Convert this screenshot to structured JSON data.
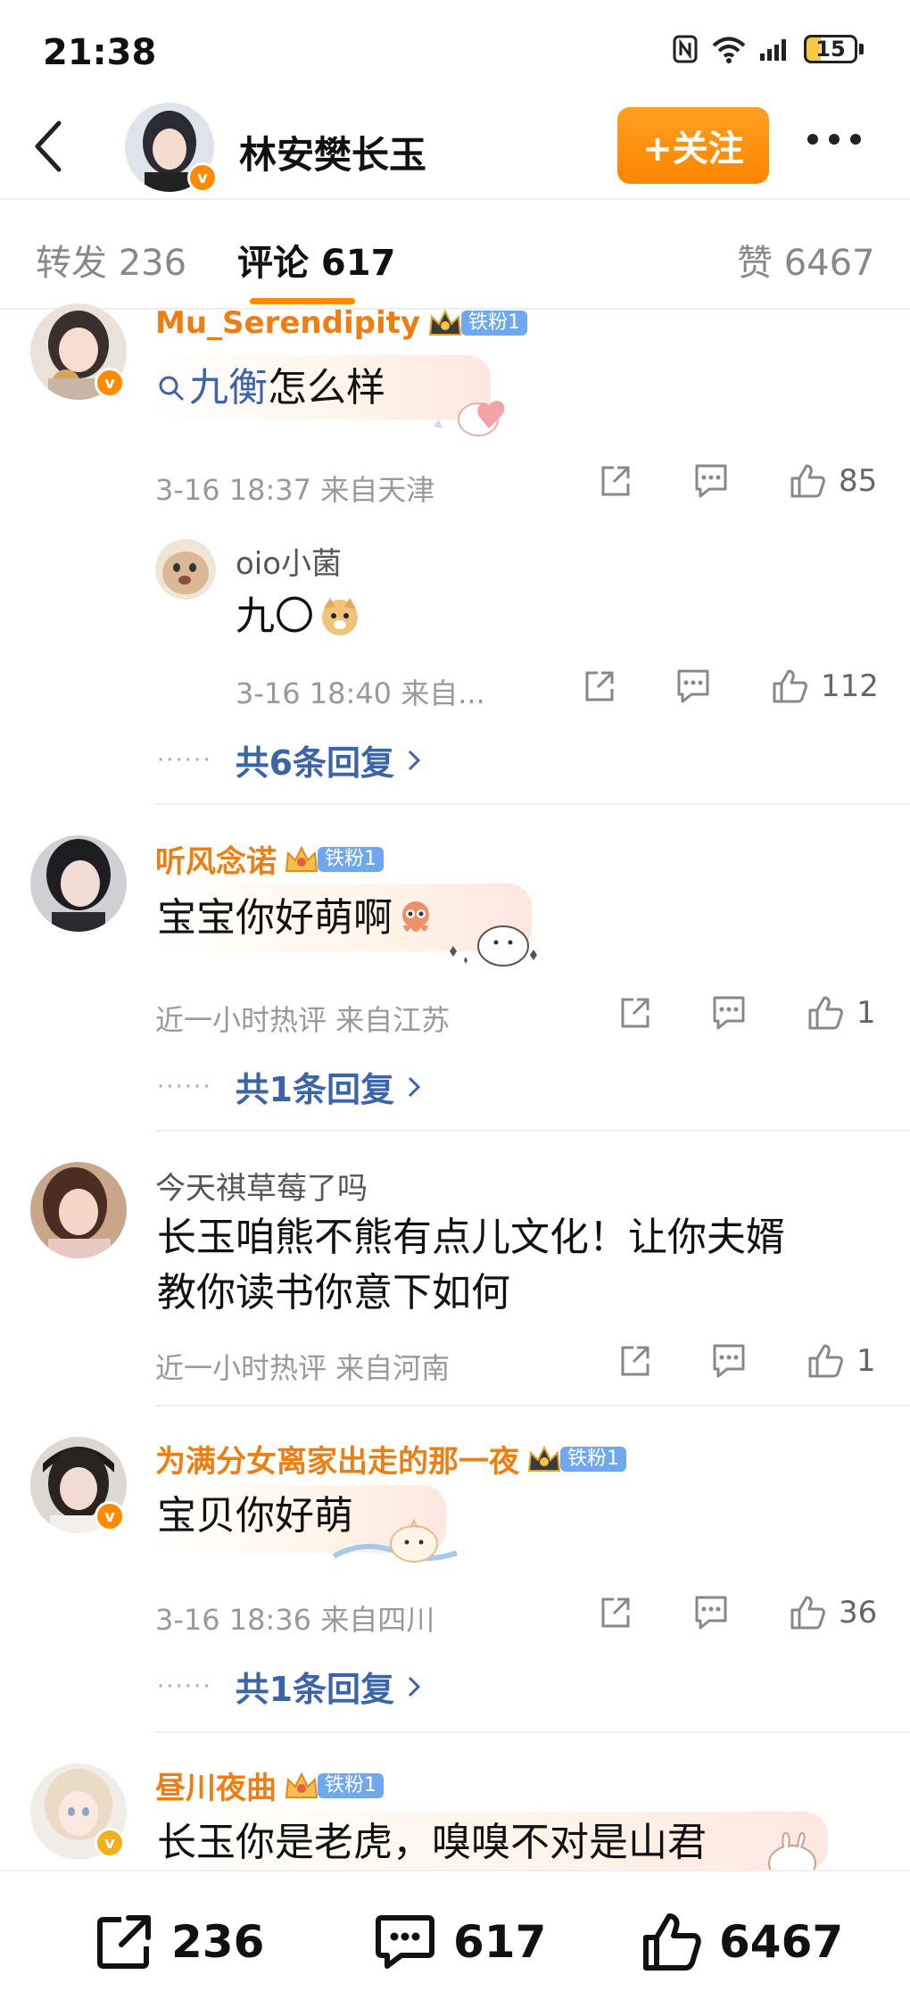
{
  "status_bar": {
    "time": "21:38",
    "battery": "15"
  },
  "header": {
    "user_name": "林安樊长玉",
    "follow_label": "+关注"
  },
  "tabs": [
    {
      "label": "转发 236"
    },
    {
      "label": "评论 617"
    },
    {
      "label": "赞 6467"
    }
  ],
  "comments": [
    {
      "user": "Mu_Serendipity",
      "fan_badge": "铁粉1",
      "text_search": "九衡",
      "text_rest": " 怎么样",
      "time_location": "3-16 18:37 来自天津",
      "likes": "85",
      "reply": {
        "user": "oio小菌",
        "text": "九〇",
        "time_location": "3-16 18:40 来自...",
        "likes": "112"
      },
      "replies_label": "共6条回复",
      "dots": "······"
    },
    {
      "user": "听风念诺",
      "fan_badge": "铁粉1",
      "text": "宝宝你好萌啊",
      "time_location": "近一小时热评 来自江苏",
      "likes": "1",
      "replies_label": "共1条回复",
      "dots": "······"
    },
    {
      "user": "今天祺草莓了吗",
      "text_line1": "长玉咱熊不熊有点儿文化！让你夫婿",
      "text_line2": "教你读书你意下如何",
      "time_location": "近一小时热评 来自河南",
      "likes": "1"
    },
    {
      "user": "为满分女离家出走的那一夜",
      "fan_badge": "铁粉1",
      "text": "宝贝你好萌",
      "time_location": "3-16 18:36 来自四川",
      "likes": "36",
      "replies_label": "共1条回复",
      "dots": "······"
    },
    {
      "user": "昼川夜曲",
      "fan_badge": "铁粉1",
      "text": "长玉你是老虎，嗅嗅不对是山君"
    }
  ],
  "bottom_bar": {
    "reposts": "236",
    "comments": "617",
    "likes": "6467"
  },
  "colors": {
    "accent": "#ff8a00",
    "username": "#ee7d12",
    "link": "#3c64a8",
    "fan_badge": "#6fa8ee"
  }
}
